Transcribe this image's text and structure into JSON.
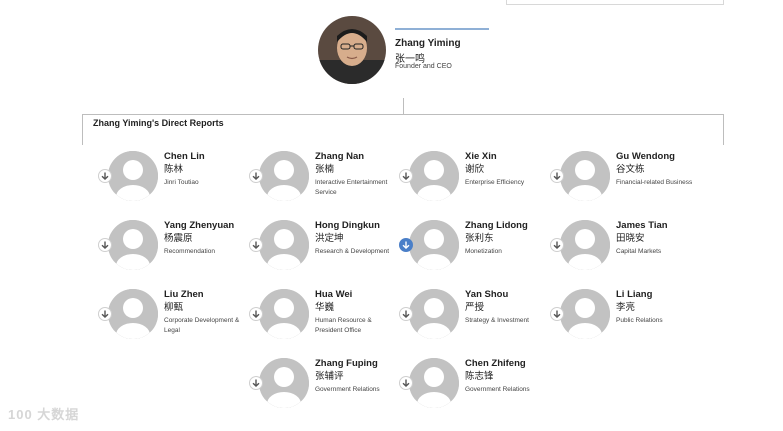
{
  "ceo": {
    "name": "Zhang Yiming",
    "name_cn": "张一鸣",
    "title": "Founder and CEO"
  },
  "section_title": "Zhang Yiming's Direct Reports",
  "reports": [
    {
      "name": "Chen Lin",
      "name_cn": "陈林",
      "role": "Jinri Toutiao",
      "expanded": false
    },
    {
      "name": "Zhang Nan",
      "name_cn": "张楠",
      "role": "Interactive Entertainment Service",
      "expanded": false
    },
    {
      "name": "Xie Xin",
      "name_cn": "谢欣",
      "role": "Enterprise Efficiency",
      "expanded": false
    },
    {
      "name": "Gu Wendong",
      "name_cn": "谷文栋",
      "role": "Financial-related Business",
      "expanded": false
    },
    {
      "name": "Yang Zhenyuan",
      "name_cn": "杨震原",
      "role": "Recommendation",
      "expanded": false
    },
    {
      "name": "Hong Dingkun",
      "name_cn": "洪定坤",
      "role": "Research & Development",
      "expanded": false
    },
    {
      "name": "Zhang Lidong",
      "name_cn": "张利东",
      "role": "Monetization",
      "expanded": true
    },
    {
      "name": "James Tian",
      "name_cn": "田晓安",
      "role": "Capital Markets",
      "expanded": false
    },
    {
      "name": "Liu Zhen",
      "name_cn": "柳甄",
      "role": "Corporate Development & Legal",
      "expanded": false
    },
    {
      "name": "Hua Wei",
      "name_cn": "华巍",
      "role": "Human Resource & President Office",
      "expanded": false
    },
    {
      "name": "Yan Shou",
      "name_cn": "严授",
      "role": "Strategy & Investment",
      "expanded": false
    },
    {
      "name": "Li Liang",
      "name_cn": "李亮",
      "role": "Public Relations",
      "expanded": false
    },
    {
      "name": "Zhang Fuping",
      "name_cn": "张辅评",
      "role": "Government Relations",
      "expanded": false
    },
    {
      "name": "Chen Zhifeng",
      "name_cn": "陈志锋",
      "role": "Government Relations",
      "expanded": false
    }
  ],
  "colors": {
    "accent": "#4a7fc8",
    "avatar_bg": "#c2c2c2",
    "avatar_fg": "#ffffff",
    "line": "#bdbdbd"
  },
  "icons": {
    "expand": "arrow-down-icon",
    "avatar": "person-placeholder-icon"
  },
  "watermark": "100 大数据"
}
